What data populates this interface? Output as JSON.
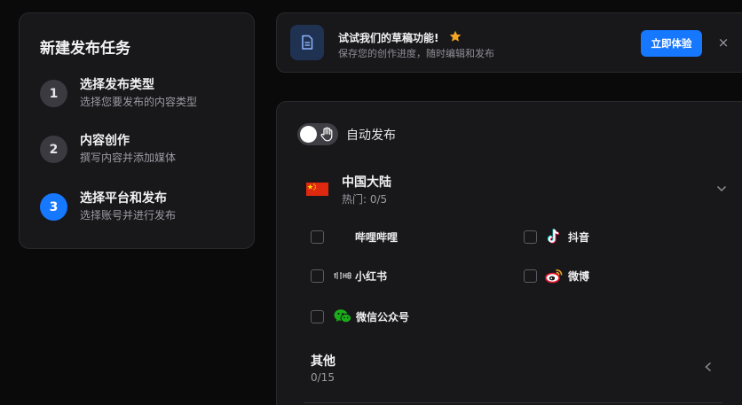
{
  "steps": {
    "title": "新建发布任务",
    "items": [
      {
        "num": "1",
        "title": "选择发布类型",
        "subtitle": "选择您要发布的内容类型",
        "active": false
      },
      {
        "num": "2",
        "title": "内容创作",
        "subtitle": "撰写内容并添加媒体",
        "active": false
      },
      {
        "num": "3",
        "title": "选择平台和发布",
        "subtitle": "选择账号并进行发布",
        "active": true
      }
    ]
  },
  "banner": {
    "title": "试试我们的草稿功能!",
    "subtitle": "保存您的创作进度，随时编辑和发布",
    "button_label": "立即体验",
    "close_label": "×",
    "accent_color": "#1677ff",
    "star_color": "#f5a524"
  },
  "publish": {
    "auto_publish_label": "自动发布",
    "auto_publish_on": false,
    "region": {
      "name": "中国大陆",
      "count": "热门: 0/5",
      "expanded": true
    },
    "platforms": [
      {
        "name": "哔哩哔哩",
        "icon": "bilibili-icon",
        "checked": false
      },
      {
        "name": "抖音",
        "icon": "douyin-icon",
        "checked": false
      },
      {
        "name": "小红书",
        "icon": "xiaohongshu-icon",
        "checked": false
      },
      {
        "name": "微博",
        "icon": "weibo-icon",
        "checked": false
      },
      {
        "name": "微信公众号",
        "icon": "wechat-icon",
        "checked": false
      }
    ],
    "other": {
      "name": "其他",
      "count": "0/15",
      "expanded": false
    }
  }
}
